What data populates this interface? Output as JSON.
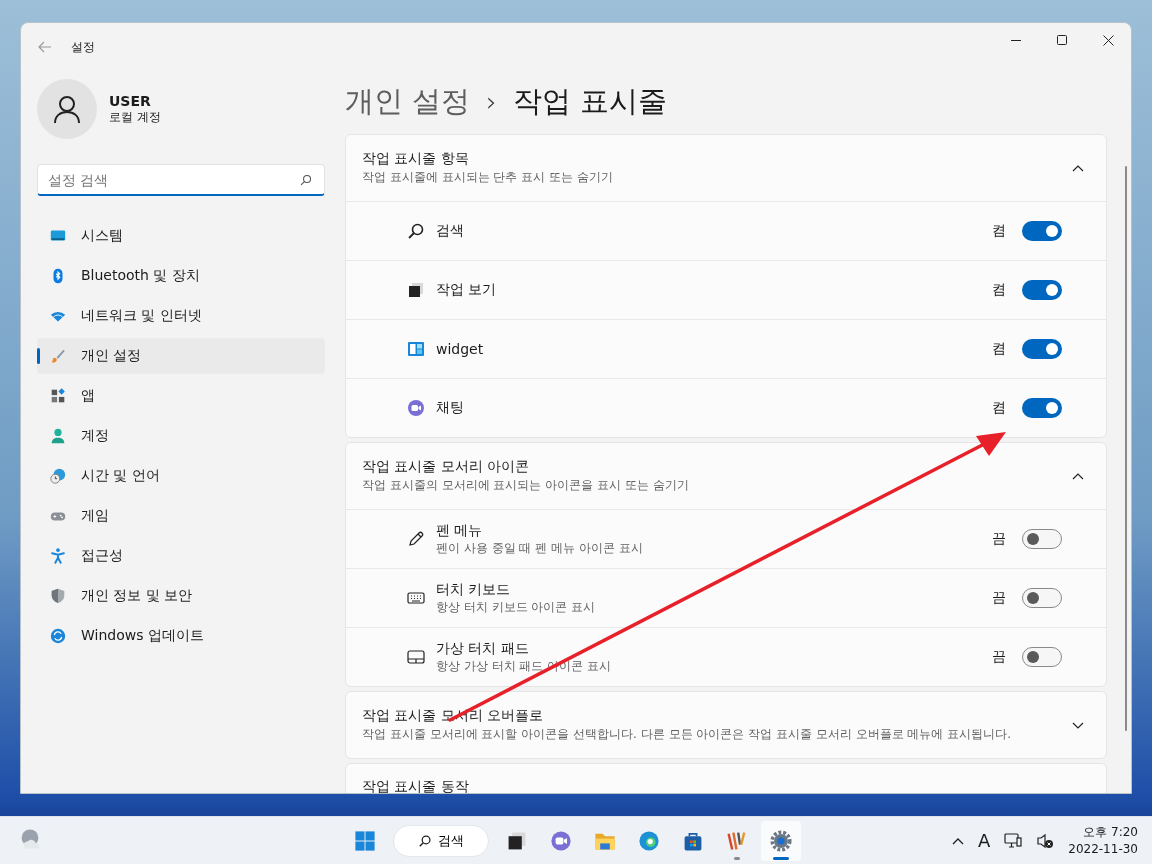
{
  "window": {
    "title": "설정"
  },
  "sidebar": {
    "user": {
      "name": "USER",
      "account": "로컬 계정"
    },
    "search": {
      "placeholder": "설정 검색"
    },
    "items": [
      {
        "kind": "system",
        "label": "시스템",
        "selected": false
      },
      {
        "kind": "bluetooth",
        "label": "Bluetooth 및 장치",
        "selected": false
      },
      {
        "kind": "network",
        "label": "네트워크 및 인터넷",
        "selected": false
      },
      {
        "kind": "personalization",
        "label": "개인 설정",
        "selected": true
      },
      {
        "kind": "apps",
        "label": "앱",
        "selected": false
      },
      {
        "kind": "accounts",
        "label": "계정",
        "selected": false
      },
      {
        "kind": "time",
        "label": "시간 및 언어",
        "selected": false
      },
      {
        "kind": "gaming",
        "label": "게임",
        "selected": false
      },
      {
        "kind": "accessibility",
        "label": "접근성",
        "selected": false
      },
      {
        "kind": "privacy",
        "label": "개인 정보 및 보안",
        "selected": false
      },
      {
        "kind": "update",
        "label": "Windows 업데이트",
        "selected": false
      }
    ]
  },
  "breadcrumb": {
    "parent": "개인 설정",
    "separator": "›",
    "current": "작업 표시줄"
  },
  "sections": [
    {
      "title": "작업 표시줄 항목",
      "description": "작업 표시줄에 표시되는 단추 표시 또는 숨기기",
      "expanded": true,
      "items": [
        {
          "kind": "search",
          "label": "검색",
          "state_text": "켬",
          "on": true
        },
        {
          "kind": "taskview",
          "label": "작업 보기",
          "state_text": "켬",
          "on": true
        },
        {
          "kind": "widget",
          "label": "widget",
          "state_text": "켬",
          "on": true
        },
        {
          "kind": "chat",
          "label": "채팅",
          "state_text": "켬",
          "on": true
        }
      ]
    },
    {
      "title": "작업 표시줄 모서리 아이콘",
      "description": "작업 표시줄의 모서리에 표시되는 아이콘을 표시 또는 숨기기",
      "expanded": true,
      "items": [
        {
          "kind": "pen",
          "label": "펜 메뉴",
          "description": "펜이 사용 중일 때 펜 메뉴 아이콘 표시",
          "state_text": "끔",
          "on": false
        },
        {
          "kind": "keyboard",
          "label": "터치 키보드",
          "description": "항상 터치 키보드 아이콘 표시",
          "state_text": "끔",
          "on": false
        },
        {
          "kind": "touchpad",
          "label": "가상 터치 패드",
          "description": "항상 가상 터치 패드 아이콘 표시",
          "state_text": "끔",
          "on": false
        }
      ]
    },
    {
      "title": "작업 표시줄 모서리 오버플로",
      "description": "작업 표시줄 모서리에 표시할 아이콘을 선택합니다. 다른 모든 아이콘은 작업 표시줄 모서리 오버플로 메뉴에 표시됩니다.",
      "expanded": false
    },
    {
      "title": "작업 표시줄 동작"
    }
  ],
  "taskbar": {
    "items": [
      {
        "kind": "start",
        "running": false,
        "active": false
      },
      {
        "kind": "search",
        "label": "검색"
      },
      {
        "kind": "taskview",
        "running": false,
        "active": false
      },
      {
        "kind": "chat",
        "running": false,
        "active": false
      },
      {
        "kind": "folder",
        "running": false,
        "active": false
      },
      {
        "kind": "browser",
        "running": false,
        "active": false
      },
      {
        "kind": "store",
        "running": false,
        "active": false
      },
      {
        "kind": "stripes",
        "running": true,
        "active": false
      },
      {
        "kind": "settings",
        "running": true,
        "active": true
      }
    ],
    "tray": {
      "ime": "A",
      "time": "오후 7:20",
      "date": "2022-11-30"
    }
  }
}
